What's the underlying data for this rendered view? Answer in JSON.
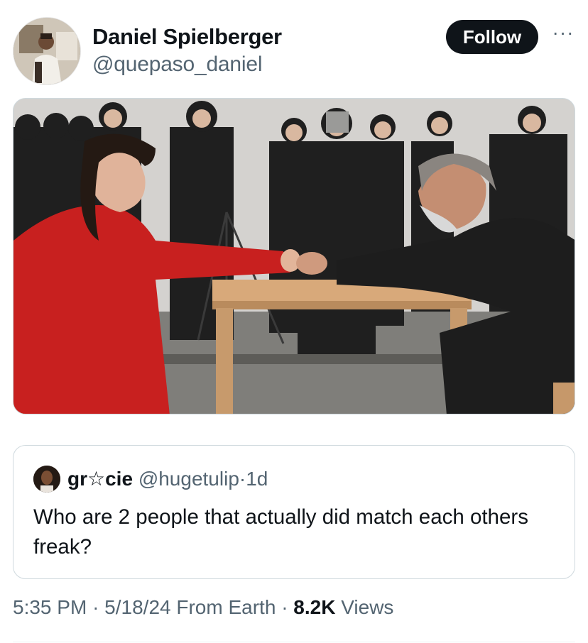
{
  "author": {
    "name": "Daniel Spielberger",
    "handle": "@quepaso_daniel",
    "avatar": "profile-photo"
  },
  "actions": {
    "follow_label": "Follow",
    "more_icon": "more-horizontal-icon"
  },
  "media": {
    "kind": "photo"
  },
  "quoted": {
    "name": "gr☆cie",
    "handle": "@hugetulip",
    "separator": "·",
    "age": "1d",
    "text": "Who are 2 people that actually did match each others freak?"
  },
  "footer": {
    "time": "5:35 PM",
    "sep1": "·",
    "date": "5/18/24",
    "source": "From Earth",
    "sep2": "·",
    "views_count": "8.2K",
    "views_label": "Views"
  },
  "colors": {
    "text_primary": "#0f1419",
    "text_secondary": "#536471",
    "border": "#cfd9de",
    "follow_bg": "#0f1419"
  }
}
